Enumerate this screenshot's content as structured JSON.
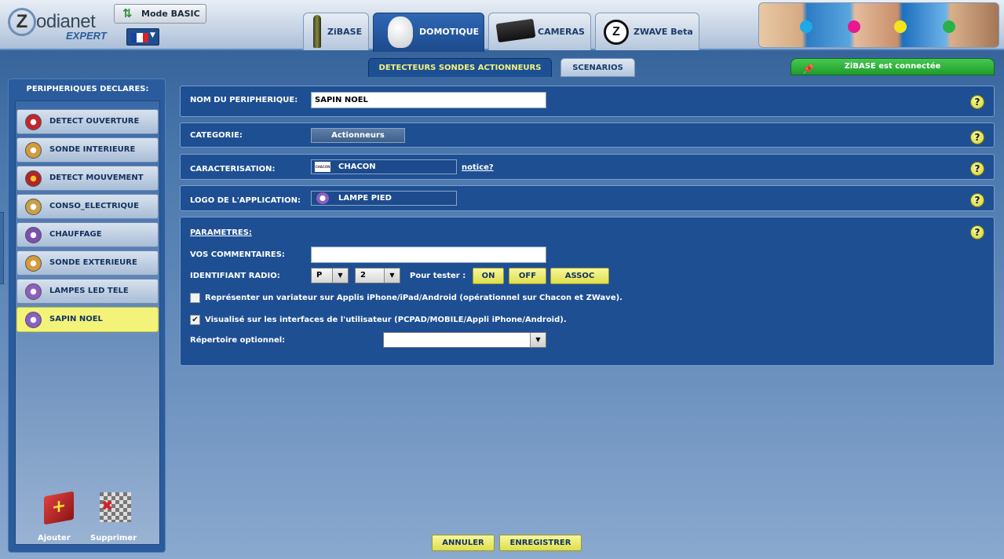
{
  "header": {
    "logo_text": "odianet",
    "logo_letter": "Z",
    "logo_sub": "EXPERT",
    "mode_label": "Mode BASIC",
    "tabs": [
      {
        "label": "ZiBASE",
        "active": false
      },
      {
        "label": "DOMOTIQUE",
        "active": true
      },
      {
        "label": "CAMERAS",
        "active": false
      },
      {
        "label": "ZWAVE Beta",
        "active": false
      }
    ],
    "zwave_letter": "Z",
    "photo_dots": [
      "#1fa9e6",
      "#e6198f",
      "#f2e51d",
      "#27b34a"
    ]
  },
  "subtabs": [
    {
      "label": "DETECTEURS SONDES ACTIONNEURS",
      "active": true
    },
    {
      "label": "SCENARIOS",
      "active": false
    }
  ],
  "status": {
    "text": "ZiBASE est connectée",
    "color": "#2fb53c"
  },
  "sidebar": {
    "title": "PERIPHERIQUES DECLARES:",
    "items": [
      {
        "label": "DETECT OUVERTURE",
        "icon": "door-sensor-icon"
      },
      {
        "label": "SONDE INTERIEURE",
        "icon": "thermometer-icon"
      },
      {
        "label": "DETECT MOUVEMENT",
        "icon": "motion-sensor-icon"
      },
      {
        "label": "CONSO_ELECTRIQUE",
        "icon": "power-plug-icon"
      },
      {
        "label": "CHAUFFAGE",
        "icon": "heating-icon"
      },
      {
        "label": "SONDE EXTERIEURE",
        "icon": "thermometer-icon"
      },
      {
        "label": "LAMPES LED TELE",
        "icon": "lamp-icon"
      },
      {
        "label": "SAPIN NOEL",
        "icon": "lamp-icon",
        "active": true
      }
    ],
    "add_label": "Ajouter",
    "delete_label": "Supprimer"
  },
  "form": {
    "name_label": "NOM DU PERIPHERIQUE:",
    "name_value": "SAPIN NOEL",
    "category_label": "CATEGORIE:",
    "category_value": "Actionneurs",
    "charac_label": "CARACTERISATION:",
    "charac_value": "CHACON",
    "charac_logo_text": "CHACON",
    "notice_label": "notice?",
    "app_logo_label": "LOGO DE L'APPLICATION:",
    "app_logo_value": "LAMPE PIED",
    "params_title": "PARAMETRES:",
    "comments_label": "VOS COMMENTAIRES:",
    "comments_value": "",
    "radio_label": "IDENTIFIANT RADIO:",
    "radio_house": "P",
    "radio_unit": "2",
    "test_label": "Pour tester :",
    "on_label": "ON",
    "off_label": "OFF",
    "assoc_label": "ASSOC",
    "dimmer_text": "Représenter un variateur sur Applis iPhone/iPad/Android (opérationnel sur Chacon et ZWave).",
    "dimmer_checked": false,
    "visible_text": "Visualisé sur les interfaces de l'utilisateur (PCPAD/MOBILE/Appli iPhone/Android).",
    "visible_checked": true,
    "directory_label": "Répertoire optionnel:",
    "directory_value": "",
    "help_glyph": "?"
  },
  "footer": {
    "cancel_label": "ANNULER",
    "save_label": "ENREGISTRER"
  }
}
